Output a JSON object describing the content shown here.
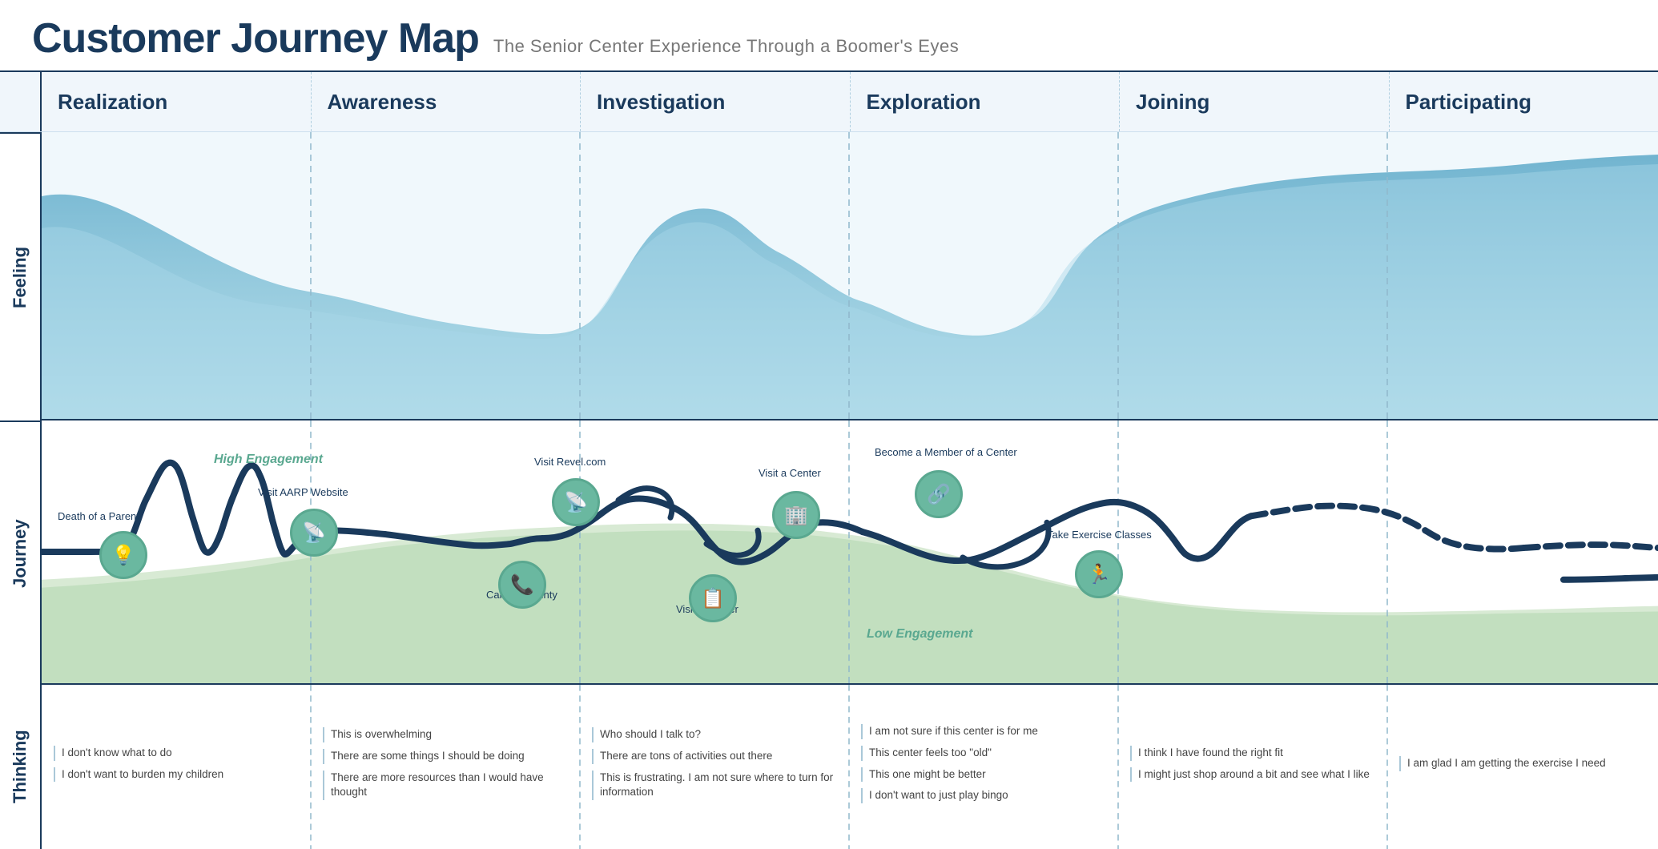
{
  "header": {
    "title": "Customer Journey Map",
    "subtitle": "The Senior Center Experience Through a Boomer's Eyes"
  },
  "phases": [
    {
      "id": "realization",
      "label": "Realization"
    },
    {
      "id": "awareness",
      "label": "Awareness"
    },
    {
      "id": "investigation",
      "label": "Investigation"
    },
    {
      "id": "exploration",
      "label": "Exploration"
    },
    {
      "id": "joining",
      "label": "Joining"
    },
    {
      "id": "participating",
      "label": "Participating"
    }
  ],
  "row_labels": {
    "feeling": "Feeling",
    "journey": "Journey",
    "thinking": "Thinking"
  },
  "journey_nodes": [
    {
      "id": "death-parent",
      "label": "Death of a Parent",
      "icon": "💡",
      "label_pos": "top"
    },
    {
      "id": "visit-aarp",
      "label": "Visit AARP Website",
      "icon": "📶",
      "label_pos": "top"
    },
    {
      "id": "visit-revel",
      "label": "Visit Revel.com",
      "icon": "📶",
      "label_pos": "top"
    },
    {
      "id": "call-county",
      "label": "Call the County",
      "icon": "📞",
      "label_pos": "right"
    },
    {
      "id": "visit-center-1",
      "label": "Visit a Center",
      "icon": "🏢",
      "label_pos": "top"
    },
    {
      "id": "visit-center-2",
      "label": "Visit a Center",
      "icon": "📋",
      "label_pos": "left"
    },
    {
      "id": "become-member",
      "label": "Become a Member of a Center",
      "icon": "🔗",
      "label_pos": "top"
    },
    {
      "id": "take-exercise",
      "label": "Take Exercise Classes",
      "icon": "🏃",
      "label_pos": "top"
    }
  ],
  "thinking_columns": [
    {
      "phase": "realization",
      "items": [
        "I don't know what to do",
        "I don't want to burden my children"
      ]
    },
    {
      "phase": "awareness",
      "items": [
        "This is overwhelming",
        "There are some things I should be doing",
        "There are more resources than I would have thought"
      ]
    },
    {
      "phase": "investigation",
      "items": [
        "Who should I talk to?",
        "There are tons of activities out there",
        "This is frustrating. I am not sure where to turn for information"
      ]
    },
    {
      "phase": "exploration",
      "items": [
        "I am not sure if this center is for me",
        "This center feels too \"old\"",
        "This one might be better",
        "I don't want to just play bingo"
      ]
    },
    {
      "phase": "joining",
      "items": [
        "I think I have found the right fit",
        "I might just shop around a bit and see what I like"
      ]
    },
    {
      "phase": "participating",
      "items": [
        "I am glad I am getting the exercise I need"
      ]
    }
  ],
  "engagement": {
    "high": "High Engagement",
    "low": "Low Engagement"
  }
}
